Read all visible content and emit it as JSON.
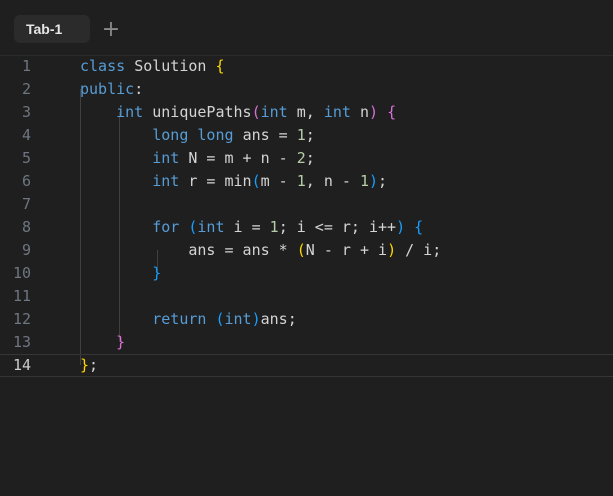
{
  "tabs": [
    {
      "label": "Tab-1"
    }
  ],
  "new_tab_symbol": "+",
  "editor": {
    "current_line": 14,
    "lines": [
      {
        "number": "1",
        "tokens": [
          [
            "class ",
            "kw"
          ],
          [
            "Solution ",
            "plain"
          ],
          [
            "{",
            "p1"
          ]
        ]
      },
      {
        "number": "2",
        "tokens": [
          [
            "public",
            "kw"
          ],
          [
            ":",
            "plain"
          ]
        ]
      },
      {
        "number": "3",
        "tokens": [
          [
            "    ",
            "plain"
          ],
          [
            "int ",
            "kw"
          ],
          [
            "uniquePaths",
            "plain"
          ],
          [
            "(",
            "p2"
          ],
          [
            "int ",
            "kw"
          ],
          [
            "m, ",
            "plain"
          ],
          [
            "int ",
            "kw"
          ],
          [
            "n",
            "plain"
          ],
          [
            ")",
            "p2"
          ],
          [
            " ",
            "plain"
          ],
          [
            "{",
            "p2"
          ]
        ]
      },
      {
        "number": "4",
        "tokens": [
          [
            "        ",
            "plain"
          ],
          [
            "long long ",
            "kw"
          ],
          [
            "ans = ",
            "plain"
          ],
          [
            "1",
            "num"
          ],
          [
            ";",
            "plain"
          ]
        ]
      },
      {
        "number": "5",
        "tokens": [
          [
            "        ",
            "plain"
          ],
          [
            "int ",
            "kw"
          ],
          [
            "N = m + n - ",
            "plain"
          ],
          [
            "2",
            "num"
          ],
          [
            ";",
            "plain"
          ]
        ]
      },
      {
        "number": "6",
        "tokens": [
          [
            "        ",
            "plain"
          ],
          [
            "int ",
            "kw"
          ],
          [
            "r = min",
            "plain"
          ],
          [
            "(",
            "p3"
          ],
          [
            "m - ",
            "plain"
          ],
          [
            "1",
            "num"
          ],
          [
            ", n - ",
            "plain"
          ],
          [
            "1",
            "num"
          ],
          [
            ")",
            "p3"
          ],
          [
            ";",
            "plain"
          ]
        ]
      },
      {
        "number": "7",
        "tokens": []
      },
      {
        "number": "8",
        "tokens": [
          [
            "        ",
            "plain"
          ],
          [
            "for ",
            "kw"
          ],
          [
            "(",
            "p3"
          ],
          [
            "int ",
            "kw"
          ],
          [
            "i = ",
            "plain"
          ],
          [
            "1",
            "num"
          ],
          [
            "; i <= r; i++",
            "plain"
          ],
          [
            ")",
            "p3"
          ],
          [
            " ",
            "plain"
          ],
          [
            "{",
            "p3"
          ]
        ]
      },
      {
        "number": "9",
        "tokens": [
          [
            "            ",
            "plain"
          ],
          [
            "ans = ans * ",
            "plain"
          ],
          [
            "(",
            "p1"
          ],
          [
            "N - r + i",
            "plain"
          ],
          [
            ")",
            "p1"
          ],
          [
            " / i;",
            "plain"
          ]
        ]
      },
      {
        "number": "10",
        "tokens": [
          [
            "        ",
            "plain"
          ],
          [
            "}",
            "p3"
          ]
        ]
      },
      {
        "number": "11",
        "tokens": []
      },
      {
        "number": "12",
        "tokens": [
          [
            "        ",
            "plain"
          ],
          [
            "return ",
            "kw"
          ],
          [
            "(",
            "p3"
          ],
          [
            "int",
            "kw"
          ],
          [
            ")",
            "p3"
          ],
          [
            "ans;",
            "plain"
          ]
        ]
      },
      {
        "number": "13",
        "tokens": [
          [
            "    ",
            "plain"
          ],
          [
            "}",
            "p2"
          ]
        ]
      },
      {
        "number": "14",
        "tokens": [
          [
            "}",
            "p1"
          ],
          [
            ";",
            "plain"
          ]
        ]
      }
    ]
  }
}
